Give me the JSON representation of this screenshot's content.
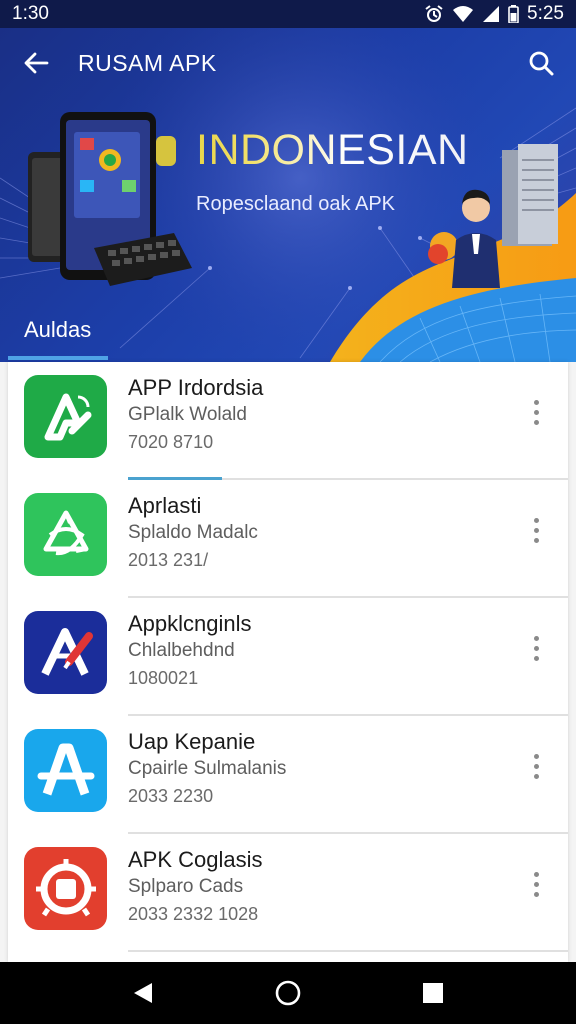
{
  "status_bar": {
    "time_left": "1:30",
    "time_right": "5:25"
  },
  "appbar": {
    "title": "RUSAM APK"
  },
  "banner": {
    "title": "INDONESIAN",
    "subtitle": "Ropesclaand oak APK"
  },
  "tab": {
    "label": "Auldas"
  },
  "apps": [
    {
      "name": "APP Irdordsia",
      "developer": "GPlalk Wolald",
      "meta": "7020 8710",
      "icon": "green-arrow-logo-icon",
      "color": "#1faa47"
    },
    {
      "name": "Aprlasti",
      "developer": "Splaldo Madalc",
      "meta": "2013 231/",
      "icon": "green-recycle-logo-icon",
      "color": "#2fc45c"
    },
    {
      "name": "Appklcnginls",
      "developer": "Chlalbehdnd",
      "meta": "1080021",
      "icon": "blue-pen-logo-icon",
      "color": "#1b2d9a"
    },
    {
      "name": "Uap Kepanie",
      "developer": "Cpairle Sulmalanis",
      "meta": "2033 2230",
      "icon": "cyan-a-logo-icon",
      "color": "#19a7ec"
    },
    {
      "name": "APK Coglasis",
      "developer": "Splparo Cads",
      "meta": "2033 2332 1028",
      "icon": "red-badge-logo-icon",
      "color": "#e23f2e"
    }
  ]
}
